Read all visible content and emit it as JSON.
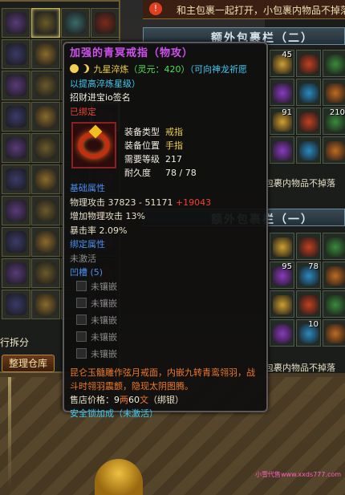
{
  "top_bar_text": "和主包裹一起打开，小包裹内物品不掉落",
  "bag_titles": [
    "额外包裹栏（二）",
    "额外包裹栏（一）"
  ],
  "bag_note": "包裹内物品不掉落",
  "left_label": "行拆分",
  "sort_button": "整理仓库",
  "bag2_counts": [
    "45",
    "",
    "",
    "",
    "",
    "",
    "91",
    "",
    "210",
    "",
    "",
    ""
  ],
  "bag1_counts": [
    "",
    "",
    "",
    "95",
    "78",
    "",
    "",
    "",
    "",
    "",
    "10",
    ""
  ],
  "tooltip": {
    "title": "加强的青冥戒指（物攻）",
    "star_label": "九星淬炼",
    "spirit": "（灵元：420）",
    "hint": "（可向神龙祈愿以提高淬炼星级）",
    "signature": "招财进宝io签名",
    "bound": "已绑定",
    "props": [
      {
        "key": "装备类型",
        "value": "戒指"
      },
      {
        "key": "装备位置",
        "value": "手指"
      },
      {
        "key": "需要等级",
        "value": "217"
      },
      {
        "key": "耐久度",
        "value": "78 / 78"
      }
    ],
    "base_header": "基础属性",
    "phys_attack_label": "物理攻击",
    "phys_attack_value": "37823 - 51171",
    "phys_attack_bonus": "+19043",
    "phys_attack_pct": "增加物理攻击 13%",
    "crit": "暴击率  2.09%",
    "bound_header": "绑定属性",
    "unactivated": "未激活",
    "sockets_header": "凹槽",
    "sockets_count": "(5)",
    "sockets": [
      "未镶嵌",
      "未镶嵌",
      "未镶嵌",
      "未镶嵌",
      "未镶嵌"
    ],
    "lore": "昆仑玉髓雕作弦月戒面，内嵌九转青鸾翎羽，战斗时翎羽震颤，隐现太阴图腾。",
    "sell_label": "售店价格：",
    "sell_liang": "9",
    "sell_liang_unit": "两",
    "sell_wen": "60",
    "sell_wen_unit": "文",
    "sell_note": "（绑银）",
    "lock_label": "安全锁加成",
    "lock_value": "（未激活）"
  },
  "watermark": "小雪代售www.xxds777.com",
  "colors": {
    "title": "#d050f0",
    "attack_bonus": "#f04030",
    "lore": "#f07a28"
  }
}
